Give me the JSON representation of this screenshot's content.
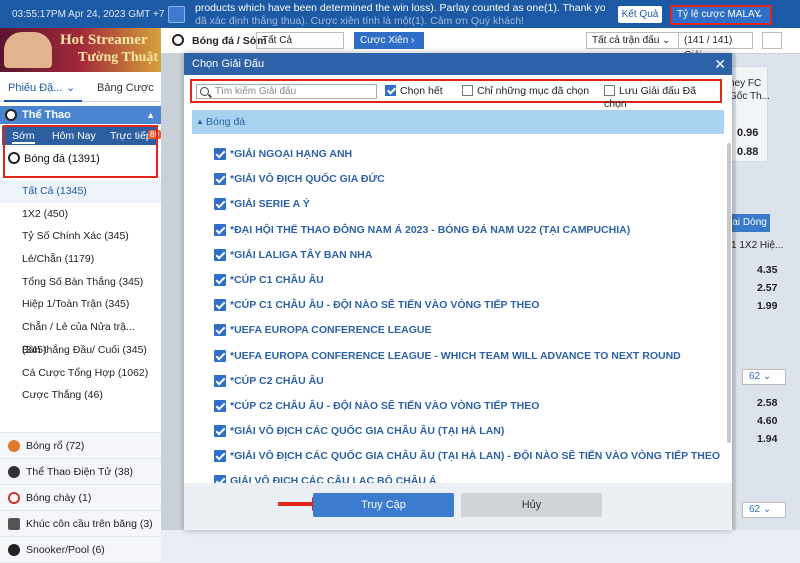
{
  "topbar": {
    "datetime": "03:55:17PM Apr 24, 2023 GMT +7",
    "ticker_line1": "products which have been determined the win loss). Parlay counted as one(1). Thank you!",
    "ticker_line2": "đã xác định thắng thua). Cược xiên tính là một(1). Cảm ơn Quý khách!",
    "results_button": "Kết Quả",
    "odds_selector": "Tỷ lệ cược MALAY",
    "odds_arrow": "⌄"
  },
  "sidebar": {
    "banner_line1": "Hot Streamer",
    "banner_line2": "Tường Thuật",
    "tabs": [
      "Phiếu Đặ...",
      "Bảng Cược"
    ],
    "sports_header": "Thể Thao",
    "subtabs": [
      "Sớm",
      "Hôm Nay",
      "Trực tiếp"
    ],
    "live_badge": "80",
    "football": "Bóng đá (1391)",
    "markets": [
      "Tất Cả (1345)",
      "1X2 (450)",
      "Tỷ Số Chính Xác (345)",
      "Lẻ/Chẵn (1179)",
      "Tổng Số Bàn Thắng (345)",
      "Hiệp 1/Toàn Trận (345)",
      "Chẵn / Lẻ của Nửa trậ... (345)",
      "Bàn thắng Đầu/ Cuối (345)",
      "Cá Cược Tổng Hợp (1062)",
      "Cược Thắng (46)"
    ],
    "other_sports": [
      {
        "label": "Bóng rổ (72)",
        "icon": "basketball-icon",
        "color": "#e07a2a"
      },
      {
        "label": "Thể Thao Điện Tử (38)",
        "icon": "headset-icon",
        "color": "#333333"
      },
      {
        "label": "Bóng chày (1)",
        "icon": "baseball-icon",
        "color": "#cc3333"
      },
      {
        "label": "Khúc côn cầu trên băng (3)",
        "icon": "hockey-icon",
        "color": "#555555"
      },
      {
        "label": "Snooker/Pool (6)",
        "icon": "snooker-icon",
        "color": "#222222"
      }
    ]
  },
  "filterbar": {
    "title": "Bóng đá / Sớm",
    "select_value": "Tất Cả",
    "parlay_button": "Cược Xiên ›",
    "all_matches": "Tất cả trận đấu ⌄",
    "league_count": "(141 / 141) Giải",
    "sort_icon": "sort-icon"
  },
  "background": {
    "card_team": "ney FC\nGốc Th...",
    "card_value1": "0.96",
    "card_value2": "0.88",
    "dropdown": "Hai Dòng ⌄",
    "header": "1   1X2 Hiệ...",
    "values": [
      "4.35",
      "2.57",
      "1.99",
      "2.58",
      "4.60",
      "1.94"
    ],
    "small_select": "62 ⌄"
  },
  "modal": {
    "title": "Chọn Giải Đấu",
    "close": "✕",
    "search_placeholder": "Tìm kiếm Giải đấu",
    "check_all": "Chọn hết",
    "only_selected": "Chỉ những mục đã chọn",
    "save_selected": "Lưu Giải đấu Đã chọn",
    "section": "Bóng đá",
    "leagues": [
      "*GIẢI NGOẠI HẠNG ANH",
      "*GIẢI VÔ ĐỊCH QUỐC GIA ĐỨC",
      "*GIẢI SERIE A Ý",
      "*ĐẠI HỘI THỂ THAO ĐÔNG NAM Á 2023 - BÓNG ĐÁ NAM U22 (TẠI CAMPUCHIA)",
      "*GIẢI LALIGA TÂY BAN NHA",
      "*CÚP C1 CHÂU ÂU",
      "*CÚP C1 CHÂU ÂU - ĐỘI NÀO SẼ TIẾN VÀO VÒNG TIẾP THEO",
      "*UEFA EUROPA CONFERENCE LEAGUE",
      "*UEFA EUROPA CONFERENCE LEAGUE - WHICH TEAM WILL ADVANCE TO NEXT ROUND",
      "*CÚP C2 CHÂU ÂU",
      "*CÚP C2 CHÂU ÂU - ĐỘI NÀO SẼ TIẾN VÀO VÒNG TIẾP THEO",
      "*GIẢI VÔ ĐỊCH CÁC QUỐC GIA CHÂU ÂU (TẠI HÀ LAN)",
      "*GIẢI VÔ ĐỊCH CÁC QUỐC GIA CHÂU ÂU (TẠI HÀ LAN) - ĐỘI NÀO SẼ TIẾN VÀO VÒNG TIẾP THEO",
      "GIẢI VÔ ĐỊCH CÁC CÂU LẠC BỘ CHÂU Á"
    ],
    "confirm_button": "Truy Cập",
    "cancel_button": "Hủy"
  },
  "colors": {
    "primary": "#1d5aa5",
    "highlight": "#e0261b",
    "section_bg": "#a9d2f1"
  }
}
